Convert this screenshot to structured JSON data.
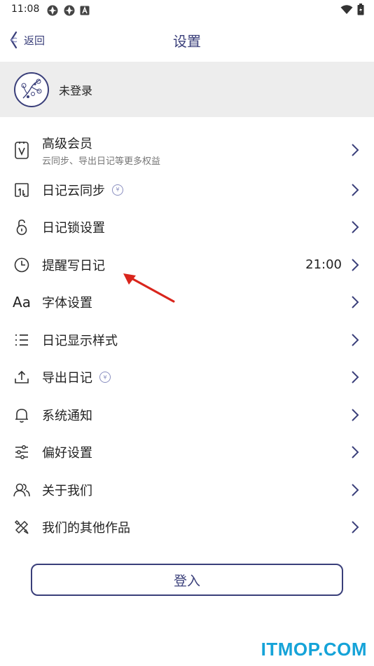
{
  "status_bar": {
    "time": "11:08"
  },
  "header": {
    "back_label": "返回",
    "title": "设置"
  },
  "account": {
    "name": "未登录"
  },
  "menu": {
    "items": [
      {
        "label": "高级会员",
        "sub": "云同步、导出日记等更多权益",
        "icon": "vip-card-icon"
      },
      {
        "label": "日记云同步",
        "icon": "cloud-sync-icon",
        "badge": "vip"
      },
      {
        "label": "日记锁设置",
        "icon": "lock-icon"
      },
      {
        "label": "提醒写日记",
        "icon": "clock-icon",
        "value": "21:00"
      },
      {
        "label": "字体设置",
        "icon": "font-icon",
        "icon_text": "Aa"
      },
      {
        "label": "日记显示样式",
        "icon": "list-icon"
      },
      {
        "label": "导出日记",
        "icon": "export-icon",
        "badge": "vip"
      },
      {
        "label": "系统通知",
        "icon": "bell-icon"
      },
      {
        "label": "偏好设置",
        "icon": "sliders-icon"
      },
      {
        "label": "关于我们",
        "icon": "people-icon"
      },
      {
        "label": "我们的其他作品",
        "icon": "tools-icon"
      }
    ]
  },
  "login_button": {
    "label": "登入"
  },
  "watermark": {
    "text": "ITMOP.COM"
  },
  "colors": {
    "accent": "#3a3f7a",
    "banner_bg": "#ededed",
    "annotation": "#d9251c",
    "watermark": "#15a3d8"
  }
}
